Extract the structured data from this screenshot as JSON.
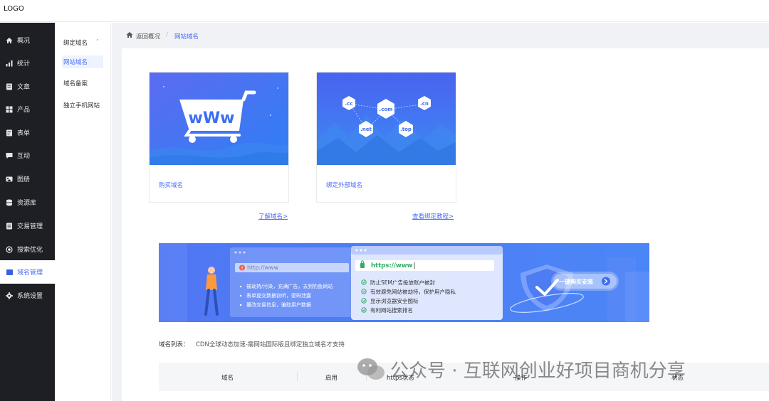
{
  "header": {
    "logo": "LOGO"
  },
  "sidebar": {
    "items": [
      {
        "label": "概况",
        "icon": "home-icon"
      },
      {
        "label": "统计",
        "icon": "stats-icon"
      },
      {
        "label": "文章",
        "icon": "article-icon"
      },
      {
        "label": "产品",
        "icon": "product-icon"
      },
      {
        "label": "表单",
        "icon": "form-icon"
      },
      {
        "label": "互动",
        "icon": "chat-icon"
      },
      {
        "label": "图册",
        "icon": "album-icon"
      },
      {
        "label": "资源库",
        "icon": "database-icon"
      },
      {
        "label": "交易管理",
        "icon": "trade-icon"
      },
      {
        "label": "搜索优化",
        "icon": "seo-icon"
      },
      {
        "label": "域名管理",
        "icon": "domain-icon",
        "active": true
      },
      {
        "label": "系统设置",
        "icon": "gear-icon"
      }
    ]
  },
  "subnav": {
    "title": "绑定域名",
    "items": [
      {
        "label": "网站域名",
        "active": true
      },
      {
        "label": "域名备案"
      },
      {
        "label": "独立手机网站"
      }
    ]
  },
  "breadcrumb": {
    "back": "返回概况",
    "separator": "/",
    "current": "网站域名"
  },
  "cards": [
    {
      "label": "购买域名",
      "link": "了解域名>"
    },
    {
      "label": "绑定外部域名",
      "link": "查看绑定教程>"
    }
  ],
  "domain_bubbles": [
    ".cc",
    ".com",
    ".cn",
    ".net",
    ".top"
  ],
  "banner": {
    "http_url": "http://www",
    "http_points": [
      "被劫持/污染，充满广告，去到钓鱼网站",
      "表单提交数据窃听，密码泄露",
      "篡改交易信息，骗取用户数据"
    ],
    "https_url": "https://www",
    "https_points": [
      "防止SEM广告投放账户被封",
      "有效避免网站被劫持，保护用户隐私",
      "显示浏览器安全图标",
      "有利网站搜索排名"
    ],
    "cta": "一键购买安装"
  },
  "domain_list": {
    "label": "域名列表：",
    "note": "CDN全球动态加速-需网站国际版且绑定独立域名才支持",
    "columns": [
      "域名",
      "启用",
      "https状态",
      "操作",
      "状态"
    ]
  },
  "watermark": "公众号 · 互联网创业好项目商机分享",
  "colors": {
    "primary": "#4a6cf7",
    "sidebar_bg": "#1d1f24",
    "banner_blue": "#4c7cf5"
  }
}
